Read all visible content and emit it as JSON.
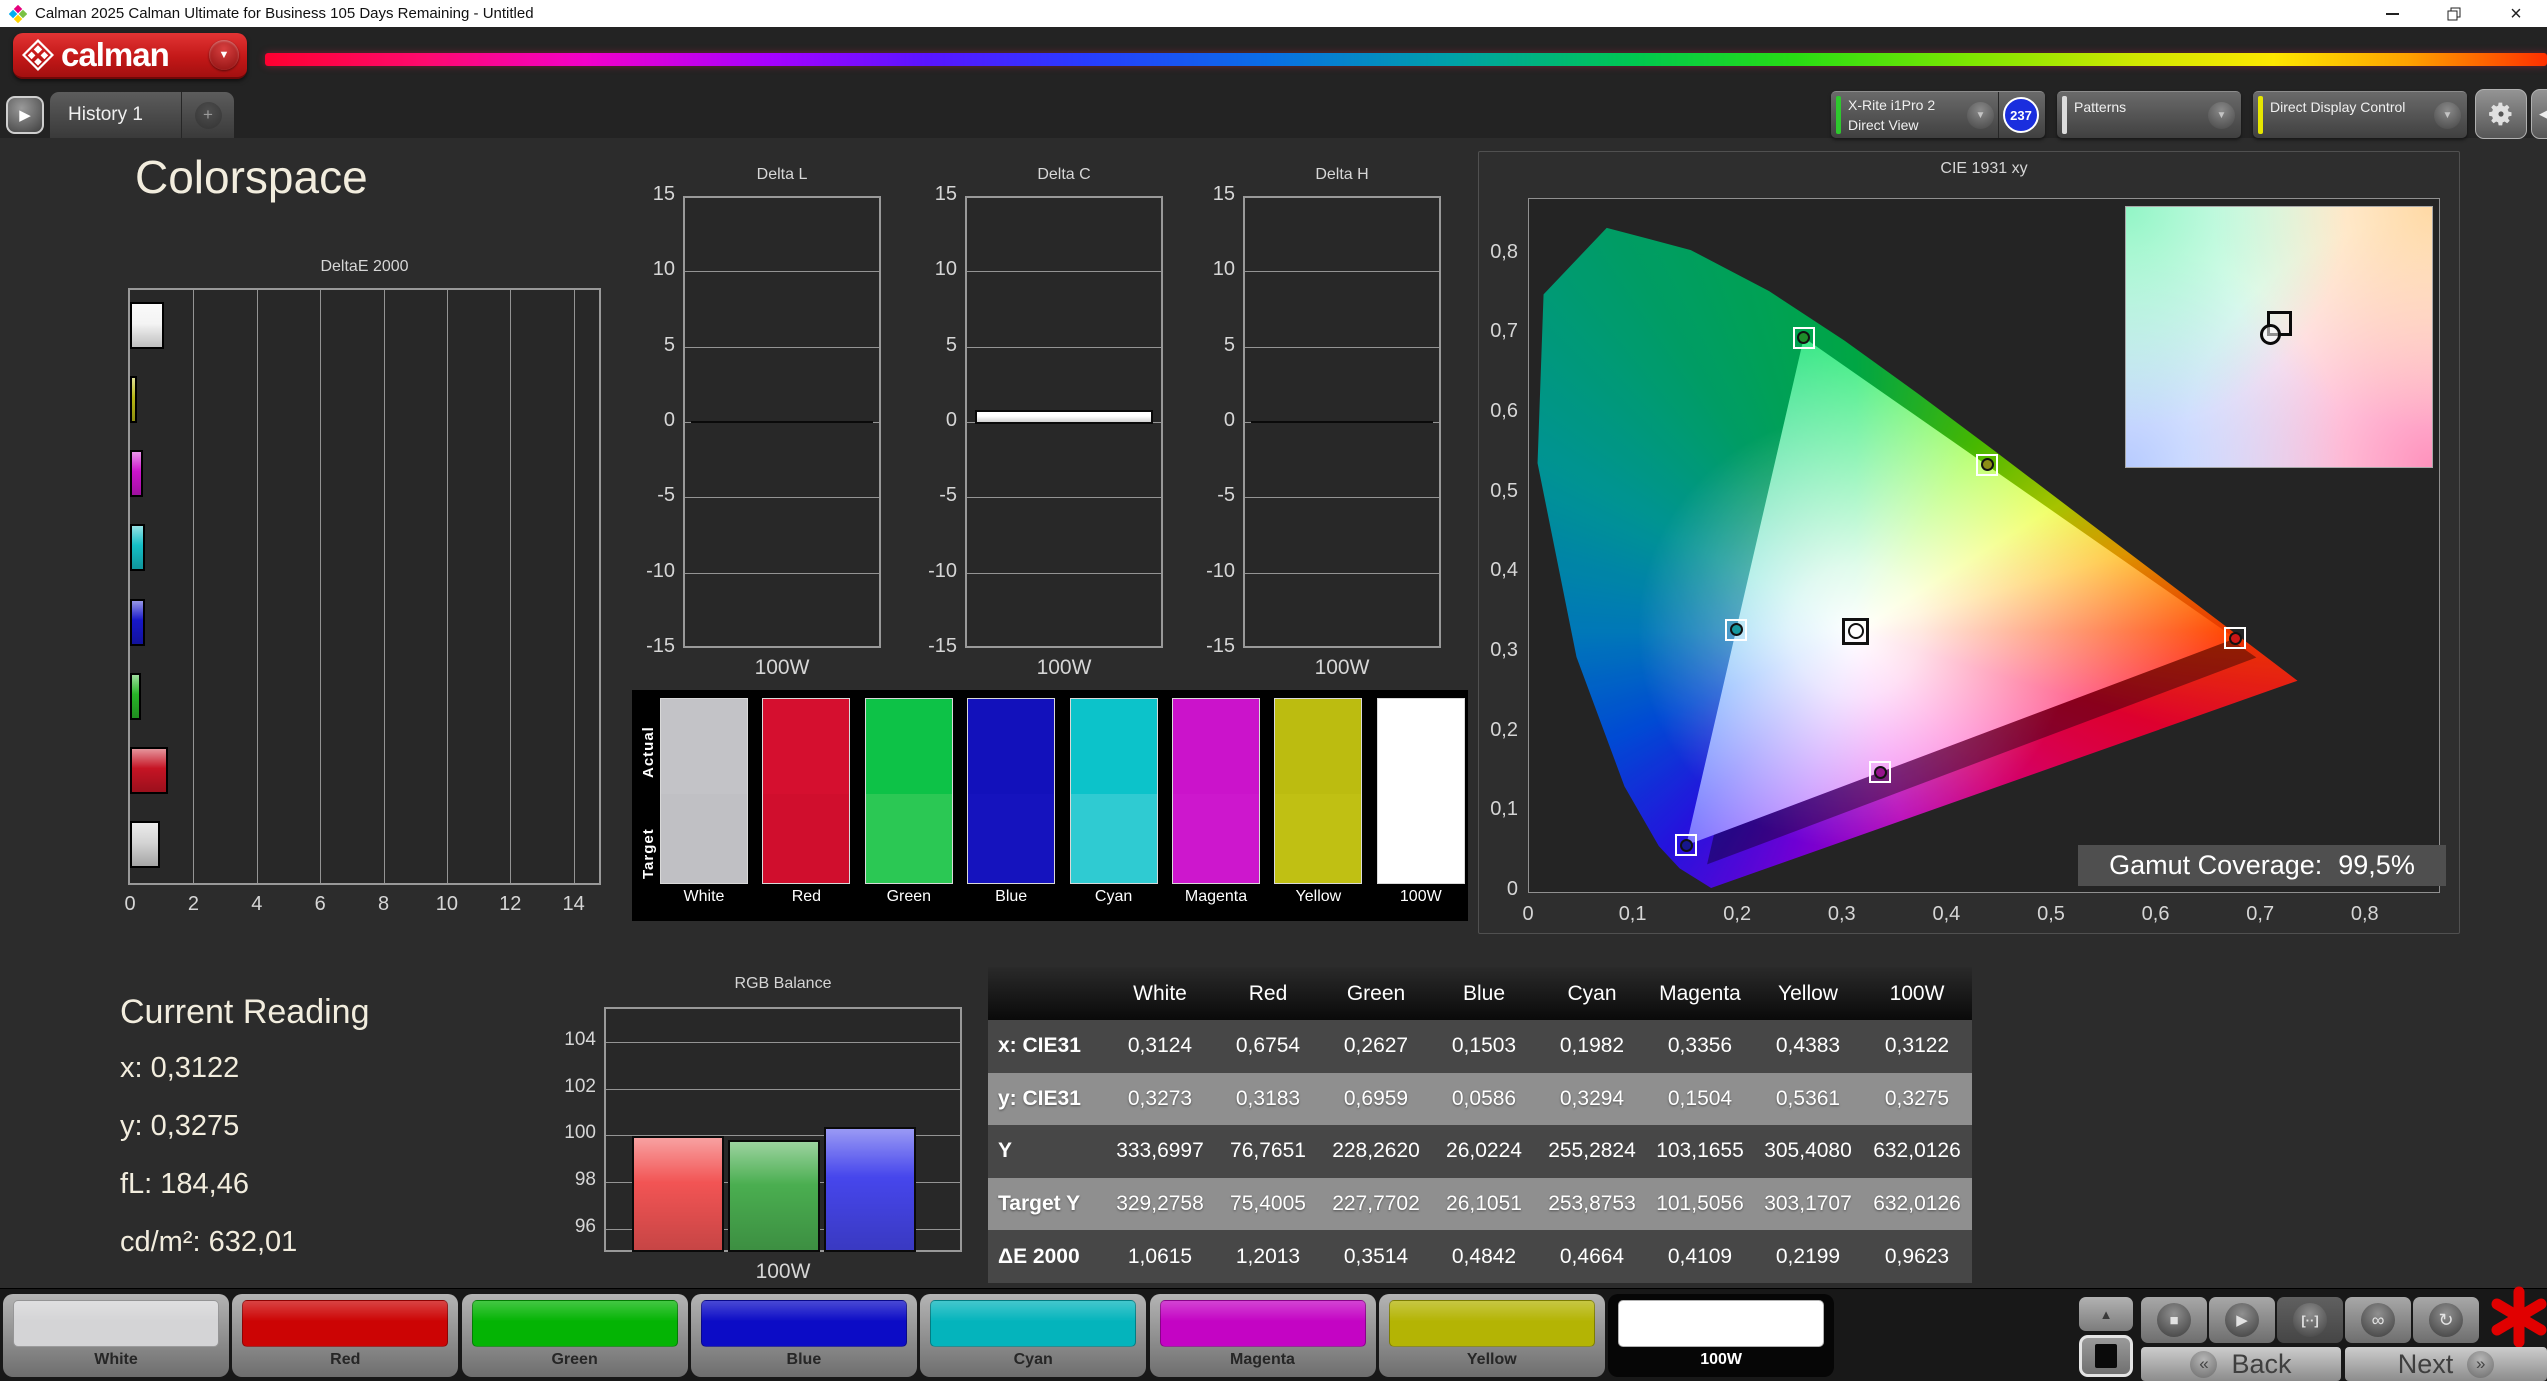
{
  "window": {
    "title": "Calman 2025 Calman Ultimate for Business 105 Days Remaining  - Untitled",
    "logo_text": "calman"
  },
  "tabs": {
    "history": "History 1",
    "add": "+"
  },
  "toolbar": {
    "meter_line1": "X-Rite i1Pro 2",
    "meter_line2": "Direct View",
    "meter_badge": "237",
    "patterns": "Patterns",
    "display_control": "Direct Display Control"
  },
  "page_title": "Colorspace",
  "chart_data": {
    "deltae": {
      "type": "bar",
      "orientation": "horizontal",
      "title": "DeltaE 2000",
      "categories": [
        "White",
        "Yellow",
        "Magenta",
        "Cyan",
        "Blue",
        "Green",
        "Red",
        "100W"
      ],
      "values": [
        1.0615,
        0.2199,
        0.4109,
        0.4664,
        0.4842,
        0.3514,
        1.2013,
        0.9623
      ],
      "colors": [
        "#f4f4f4",
        "#b6b614",
        "#cc14cc",
        "#14bec6",
        "#1717c8",
        "#28b428",
        "#c61424",
        "#d4d4d4"
      ],
      "xticks": [
        "0",
        "2",
        "4",
        "6",
        "8",
        "10",
        "12",
        "14"
      ],
      "xlim": [
        0,
        14.8
      ]
    },
    "delta_lch": {
      "type": "bar",
      "charts": [
        {
          "title": "Delta L",
          "category": "100W",
          "value": 0.0
        },
        {
          "title": "Delta C",
          "category": "100W",
          "value": 0.8
        },
        {
          "title": "Delta H",
          "category": "100W",
          "value": 0.0
        }
      ],
      "yticks": [
        "15",
        "10",
        "5",
        "0",
        "-5",
        "-10",
        "-15"
      ],
      "ylim": [
        -15,
        15
      ],
      "xlabel": "100W"
    },
    "rgb_balance": {
      "type": "bar",
      "title": "RGB Balance",
      "xlabel": "100W",
      "series": [
        {
          "name": "Red",
          "value": 100.07,
          "color": "#f25454"
        },
        {
          "name": "Green",
          "value": 99.88,
          "color": "#4aae50"
        },
        {
          "name": "Blue",
          "value": 100.45,
          "color": "#4646ec"
        }
      ],
      "yticks": [
        "104",
        "102",
        "100",
        "98",
        "96"
      ],
      "ylim": [
        95,
        105.5
      ]
    },
    "cie": {
      "type": "scatter",
      "title": "CIE 1931 xy",
      "xticks": [
        "0",
        "0,1",
        "0,2",
        "0,3",
        "0,4",
        "0,5",
        "0,6",
        "0,7",
        "0,8"
      ],
      "yticks": [
        "0,8",
        "0,7",
        "0,6",
        "0,5",
        "0,4",
        "0,3",
        "0,2",
        "0,1",
        "0"
      ],
      "axis_max": 0.87,
      "gamut_label": "Gamut Coverage:",
      "gamut_value": "99,5%",
      "points": [
        {
          "name": "white",
          "x": 0.3124,
          "y": 0.3273,
          "color": "#ffffff"
        },
        {
          "name": "red",
          "x": 0.6754,
          "y": 0.3183,
          "color": "#cc1616"
        },
        {
          "name": "green",
          "x": 0.2627,
          "y": 0.6959,
          "color": "#1e8c2a"
        },
        {
          "name": "blue",
          "x": 0.1503,
          "y": 0.0586,
          "color": "#16168c"
        },
        {
          "name": "cyan",
          "x": 0.1982,
          "y": 0.3294,
          "color": "#16989e"
        },
        {
          "name": "magenta",
          "x": 0.3356,
          "y": 0.1504,
          "color": "#96148c"
        },
        {
          "name": "yellow",
          "x": 0.4383,
          "y": 0.5361,
          "color": "#8c8c16"
        }
      ],
      "triangle": {
        "r": [
          0.6754,
          0.3183
        ],
        "g": [
          0.2627,
          0.6959
        ],
        "b": [
          0.1503,
          0.0586
        ]
      }
    }
  },
  "swatch_panel": {
    "actual_label": "Actual",
    "target_label": "Target",
    "columns": [
      {
        "label": "White",
        "actual": "#c3c3c7",
        "target": "#c0c0c4"
      },
      {
        "label": "Red",
        "actual": "#d50f2f",
        "target": "#d00e2d"
      },
      {
        "label": "Green",
        "actual": "#0dc247",
        "target": "#2bc854"
      },
      {
        "label": "Blue",
        "actual": "#1211bb",
        "target": "#1513be"
      },
      {
        "label": "Cyan",
        "actual": "#0cc3ca",
        "target": "#2fcbd2"
      },
      {
        "label": "Magenta",
        "actual": "#cb13cb",
        "target": "#cd17cd"
      },
      {
        "label": "Yellow",
        "actual": "#bcbc10",
        "target": "#c0c013"
      },
      {
        "label": "100W",
        "actual": "#ffffff",
        "target": "#ffffff"
      }
    ]
  },
  "current_reading": {
    "title": "Current Reading",
    "lines": [
      "x: 0,3122",
      "y: 0,3275",
      "fL: 184,46",
      "cd/m²: 632,01"
    ]
  },
  "table": {
    "headers": [
      "",
      "White",
      "Red",
      "Green",
      "Blue",
      "Cyan",
      "Magenta",
      "Yellow",
      "100W"
    ],
    "rows": [
      {
        "label": "x: CIE31",
        "values": [
          "0,3124",
          "0,6754",
          "0,2627",
          "0,1503",
          "0,1982",
          "0,3356",
          "0,4383",
          "0,3122"
        ]
      },
      {
        "label": "y: CIE31",
        "values": [
          "0,3273",
          "0,3183",
          "0,6959",
          "0,0586",
          "0,3294",
          "0,1504",
          "0,5361",
          "0,3275"
        ]
      },
      {
        "label": "Y",
        "values": [
          "333,6997",
          "76,7651",
          "228,2620",
          "26,0224",
          "255,2824",
          "103,1655",
          "305,4080",
          "632,0126"
        ]
      },
      {
        "label": "Target Y",
        "values": [
          "329,2758",
          "75,4005",
          "227,7702",
          "26,1051",
          "253,8753",
          "101,5056",
          "303,1707",
          "632,0126"
        ]
      },
      {
        "label": "ΔE 2000",
        "values": [
          "1,0615",
          "1,2013",
          "0,3514",
          "0,4842",
          "0,4664",
          "0,4109",
          "0,2199",
          "0,9623"
        ]
      }
    ]
  },
  "bottom": {
    "patterns": [
      {
        "label": "White",
        "color": "#d4d4d6",
        "selected": false
      },
      {
        "label": "Red",
        "color": "#cc0404",
        "selected": false
      },
      {
        "label": "Green",
        "color": "#04b404",
        "selected": false
      },
      {
        "label": "Blue",
        "color": "#0c0cc6",
        "selected": false
      },
      {
        "label": "Cyan",
        "color": "#04b4bc",
        "selected": false
      },
      {
        "label": "Magenta",
        "color": "#c404c4",
        "selected": false
      },
      {
        "label": "Yellow",
        "color": "#b4b404",
        "selected": false
      },
      {
        "label": "100W",
        "color": "#ffffff",
        "selected": true
      }
    ],
    "back": "Back",
    "next": "Next"
  }
}
